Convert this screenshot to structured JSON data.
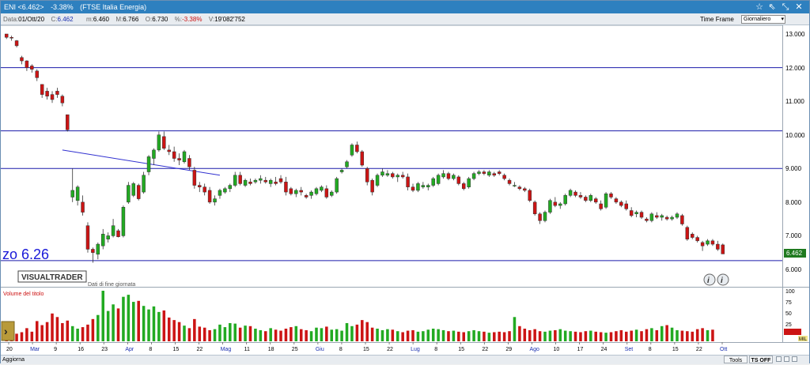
{
  "window": {
    "title_symbol": "ENI <6.462>",
    "title_change": "-3.38%",
    "title_index": "(FTSE Italia Energia)"
  },
  "info": {
    "date_label": "Data:",
    "date": "01/Ott/20",
    "close_label": "C:",
    "close": "6.462",
    "low_label": "m:",
    "low": "6.460",
    "high_label": "M:",
    "high": "6.766",
    "open_label": "O:",
    "open": "6.730",
    "pct_label": "%:",
    "pct": "-3.38%",
    "vol_label": "V:",
    "volume": "19'082'752"
  },
  "timeframe": {
    "label": "Time Frame",
    "selected": "Giornaliero"
  },
  "price_axis": {
    "ticks": [
      "13.000",
      "12.000",
      "11.000",
      "10.000",
      "9.000",
      "8.000",
      "7.000",
      "6.000"
    ],
    "last_price_badge": "6.462"
  },
  "volume_axis": {
    "ticks": [
      "100",
      "75",
      "50",
      "25"
    ],
    "unit": "MIL",
    "title": "Volume del titolo"
  },
  "overlay_text": "zo 6.26",
  "logo": {
    "text": "VISUALTRADER",
    "subtitle": "Dati di fine giornata"
  },
  "x_axis": {
    "labels": [
      "20",
      "Mar",
      "9",
      "16",
      "23",
      "Apr",
      "8",
      "15",
      "22",
      "Mag",
      "11",
      "18",
      "25",
      "Giu",
      "8",
      "15",
      "22",
      "Lug",
      "8",
      "15",
      "22",
      "29",
      "Ago",
      "10",
      "17",
      "24",
      "Set",
      "8",
      "15",
      "22",
      "Ott"
    ],
    "month_labels": [
      "Mar",
      "Apr",
      "Mag",
      "Giu",
      "Lug",
      "Ago",
      "Set",
      "Ott"
    ]
  },
  "bottom": {
    "refresh": "Aggiorna",
    "tools": "Tools",
    "ts_off": "TS OFF"
  },
  "colors": {
    "up": "#22aa22",
    "down": "#cc1414",
    "hline": "#1a1aaa",
    "trend": "#3030d0"
  },
  "chart_data": {
    "type": "candlestick",
    "title": "ENI <6.462> -3.38% (FTSE Italia Energia)",
    "ylim": [
      5.8,
      13.2
    ],
    "horizontal_levels": [
      12.0,
      10.12,
      9.0,
      6.26
    ],
    "trendline": [
      [
        11,
        9.55
      ],
      [
        42,
        8.8
      ]
    ],
    "candles": [
      [
        13.0,
        12.95,
        12.85,
        12.9
      ],
      [
        12.9,
        12.95,
        12.8,
        12.88
      ],
      [
        12.8,
        12.82,
        12.6,
        12.65
      ],
      [
        12.3,
        12.35,
        12.1,
        12.2
      ],
      [
        12.2,
        12.22,
        11.9,
        12.0
      ],
      [
        12.05,
        12.1,
        11.85,
        11.95
      ],
      [
        11.9,
        11.95,
        11.6,
        11.7
      ],
      [
        11.5,
        11.5,
        11.1,
        11.2
      ],
      [
        11.3,
        11.4,
        11.05,
        11.15
      ],
      [
        11.2,
        11.3,
        10.95,
        11.05
      ],
      [
        11.3,
        11.4,
        11.1,
        11.2
      ],
      [
        11.15,
        11.2,
        10.85,
        10.95
      ],
      [
        10.6,
        10.6,
        10.1,
        10.15
      ],
      [
        8.15,
        9.0,
        8.0,
        8.35
      ],
      [
        8.05,
        8.5,
        7.9,
        8.45
      ],
      [
        8.0,
        8.2,
        7.6,
        7.7
      ],
      [
        7.3,
        7.4,
        6.5,
        6.6
      ],
      [
        6.6,
        6.65,
        6.2,
        6.5
      ],
      [
        6.45,
        6.8,
        6.3,
        6.75
      ],
      [
        6.7,
        7.2,
        6.6,
        7.05
      ],
      [
        6.9,
        7.1,
        6.8,
        7.0
      ],
      [
        7.0,
        7.5,
        6.95,
        7.3
      ],
      [
        7.15,
        7.2,
        6.95,
        6.97
      ],
      [
        7.0,
        7.9,
        6.95,
        7.85
      ],
      [
        8.0,
        8.6,
        7.95,
        8.5
      ],
      [
        8.2,
        8.6,
        8.15,
        8.55
      ],
      [
        8.5,
        8.55,
        8.05,
        8.1
      ],
      [
        8.3,
        8.9,
        8.25,
        8.8
      ],
      [
        8.9,
        9.4,
        8.8,
        9.35
      ],
      [
        9.3,
        9.6,
        9.1,
        9.55
      ],
      [
        9.55,
        10.1,
        9.5,
        10.0
      ],
      [
        9.95,
        10.1,
        9.55,
        9.6
      ],
      [
        9.55,
        9.7,
        9.4,
        9.5
      ],
      [
        9.5,
        9.65,
        9.2,
        9.3
      ],
      [
        9.3,
        9.45,
        9.1,
        9.25
      ],
      [
        9.2,
        9.55,
        9.15,
        9.5
      ],
      [
        9.3,
        9.4,
        8.95,
        9.05
      ],
      [
        8.95,
        9.05,
        8.4,
        8.5
      ],
      [
        8.5,
        8.6,
        8.3,
        8.45
      ],
      [
        8.45,
        8.55,
        8.2,
        8.3
      ],
      [
        8.35,
        8.45,
        7.95,
        8.0
      ],
      [
        8.0,
        8.2,
        7.9,
        8.1
      ],
      [
        8.2,
        8.4,
        8.1,
        8.35
      ],
      [
        8.3,
        8.45,
        8.25,
        8.4
      ],
      [
        8.4,
        8.55,
        8.3,
        8.5
      ],
      [
        8.5,
        8.9,
        8.45,
        8.8
      ],
      [
        8.8,
        8.9,
        8.5,
        8.55
      ],
      [
        8.5,
        8.7,
        8.45,
        8.65
      ],
      [
        8.6,
        8.7,
        8.5,
        8.55
      ],
      [
        8.6,
        8.7,
        8.55,
        8.65
      ],
      [
        8.65,
        8.8,
        8.55,
        8.7
      ],
      [
        8.65,
        8.75,
        8.55,
        8.6
      ],
      [
        8.55,
        8.7,
        8.45,
        8.65
      ],
      [
        8.6,
        8.75,
        8.5,
        8.55
      ],
      [
        8.7,
        8.8,
        8.55,
        8.6
      ],
      [
        8.6,
        8.75,
        8.2,
        8.3
      ],
      [
        8.4,
        8.45,
        8.2,
        8.25
      ],
      [
        8.25,
        8.4,
        8.15,
        8.35
      ],
      [
        8.35,
        8.45,
        8.2,
        8.3
      ],
      [
        8.2,
        8.25,
        8.1,
        8.15
      ],
      [
        8.2,
        8.35,
        8.1,
        8.3
      ],
      [
        8.25,
        8.45,
        8.2,
        8.4
      ],
      [
        8.35,
        8.5,
        8.3,
        8.45
      ],
      [
        8.4,
        8.5,
        8.1,
        8.15
      ],
      [
        8.2,
        8.35,
        8.15,
        8.3
      ],
      [
        8.3,
        8.75,
        8.25,
        8.7
      ],
      [
        8.9,
        9.0,
        8.85,
        8.95
      ],
      [
        9.05,
        9.25,
        9.0,
        9.2
      ],
      [
        9.4,
        9.75,
        9.35,
        9.7
      ],
      [
        9.7,
        9.8,
        9.45,
        9.5
      ],
      [
        9.5,
        9.55,
        9.05,
        9.1
      ],
      [
        9.0,
        9.05,
        8.5,
        8.6
      ],
      [
        8.65,
        8.7,
        8.2,
        8.3
      ],
      [
        8.5,
        8.85,
        8.45,
        8.8
      ],
      [
        8.8,
        9.0,
        8.75,
        8.9
      ],
      [
        8.8,
        8.95,
        8.75,
        8.85
      ],
      [
        8.85,
        8.9,
        8.7,
        8.75
      ],
      [
        8.75,
        8.85,
        8.6,
        8.8
      ],
      [
        8.8,
        8.9,
        8.7,
        8.75
      ],
      [
        8.75,
        8.85,
        8.35,
        8.45
      ],
      [
        8.45,
        8.55,
        8.3,
        8.35
      ],
      [
        8.35,
        8.6,
        8.3,
        8.55
      ],
      [
        8.45,
        8.6,
        8.4,
        8.5
      ],
      [
        8.45,
        8.55,
        8.35,
        8.5
      ],
      [
        8.5,
        8.75,
        8.45,
        8.7
      ],
      [
        8.55,
        8.85,
        8.5,
        8.8
      ],
      [
        8.75,
        8.95,
        8.7,
        8.85
      ],
      [
        8.85,
        8.9,
        8.65,
        8.7
      ],
      [
        8.7,
        8.85,
        8.65,
        8.8
      ],
      [
        8.75,
        8.8,
        8.5,
        8.55
      ],
      [
        8.55,
        8.6,
        8.35,
        8.4
      ],
      [
        8.45,
        8.75,
        8.4,
        8.7
      ],
      [
        8.7,
        8.9,
        8.65,
        8.85
      ],
      [
        8.85,
        8.95,
        8.8,
        8.9
      ],
      [
        8.9,
        8.95,
        8.8,
        8.85
      ],
      [
        8.8,
        8.95,
        8.75,
        8.9
      ],
      [
        8.85,
        8.9,
        8.75,
        8.8
      ],
      [
        8.9,
        8.95,
        8.8,
        8.85
      ],
      [
        8.8,
        8.85,
        8.65,
        8.7
      ],
      [
        8.65,
        8.7,
        8.5,
        8.55
      ],
      [
        8.5,
        8.6,
        8.45,
        8.5
      ],
      [
        8.45,
        8.5,
        8.35,
        8.4
      ],
      [
        8.4,
        8.45,
        8.3,
        8.35
      ],
      [
        8.35,
        8.4,
        8.0,
        8.05
      ],
      [
        8.0,
        8.05,
        7.6,
        7.65
      ],
      [
        7.65,
        7.7,
        7.35,
        7.45
      ],
      [
        7.45,
        7.75,
        7.4,
        7.7
      ],
      [
        7.7,
        8.1,
        7.65,
        8.05
      ],
      [
        8.0,
        8.15,
        7.85,
        7.9
      ],
      [
        7.9,
        8.0,
        7.8,
        7.95
      ],
      [
        7.95,
        8.25,
        7.9,
        8.2
      ],
      [
        8.2,
        8.4,
        8.15,
        8.35
      ],
      [
        8.3,
        8.35,
        8.15,
        8.2
      ],
      [
        8.2,
        8.3,
        8.1,
        8.15
      ],
      [
        8.15,
        8.2,
        8.0,
        8.05
      ],
      [
        8.05,
        8.25,
        8.0,
        8.2
      ],
      [
        8.1,
        8.15,
        7.95,
        8.0
      ],
      [
        7.95,
        8.05,
        7.75,
        7.8
      ],
      [
        7.85,
        8.3,
        7.8,
        8.25
      ],
      [
        8.25,
        8.3,
        8.1,
        8.15
      ],
      [
        8.1,
        8.15,
        7.95,
        8.0
      ],
      [
        8.0,
        8.05,
        7.85,
        7.9
      ],
      [
        7.95,
        8.05,
        7.75,
        7.8
      ],
      [
        7.75,
        7.85,
        7.55,
        7.6
      ],
      [
        7.65,
        7.75,
        7.55,
        7.7
      ],
      [
        7.7,
        7.75,
        7.5,
        7.55
      ],
      [
        7.5,
        7.55,
        7.4,
        7.45
      ],
      [
        7.45,
        7.7,
        7.4,
        7.65
      ],
      [
        7.6,
        7.7,
        7.5,
        7.55
      ],
      [
        7.55,
        7.65,
        7.45,
        7.6
      ],
      [
        7.55,
        7.6,
        7.45,
        7.5
      ],
      [
        7.5,
        7.6,
        7.45,
        7.55
      ],
      [
        7.55,
        7.7,
        7.5,
        7.65
      ],
      [
        7.6,
        7.65,
        7.3,
        7.35
      ],
      [
        7.25,
        7.3,
        6.85,
        6.9
      ],
      [
        7.05,
        7.1,
        6.9,
        6.95
      ],
      [
        6.95,
        7.0,
        6.8,
        6.85
      ],
      [
        6.8,
        6.85,
        6.55,
        6.7
      ],
      [
        6.75,
        6.9,
        6.7,
        6.85
      ],
      [
        6.85,
        6.9,
        6.7,
        6.75
      ],
      [
        6.75,
        6.85,
        6.55,
        6.6
      ],
      [
        6.73,
        6.77,
        6.46,
        6.46
      ]
    ],
    "volumes": [
      22,
      34,
      15,
      18,
      26,
      19,
      40,
      32,
      38,
      55,
      48,
      36,
      41,
      30,
      25,
      28,
      33,
      44,
      52,
      100,
      60,
      73,
      65,
      88,
      92,
      78,
      80,
      70,
      63,
      69,
      58,
      61,
      47,
      42,
      38,
      31,
      26,
      44,
      29,
      27,
      22,
      24,
      33,
      28,
      36,
      35,
      27,
      31,
      30,
      25,
      22,
      20,
      26,
      23,
      21,
      25,
      28,
      30,
      24,
      22,
      20,
      27,
      26,
      29,
      23,
      24,
      21,
      36,
      30,
      33,
      42,
      38,
      27,
      25,
      22,
      24,
      23,
      20,
      18,
      21,
      22,
      19,
      20,
      23,
      25,
      24,
      22,
      20,
      21,
      19,
      18,
      20,
      22,
      20,
      19,
      17,
      18,
      19,
      18,
      20,
      48,
      30,
      25,
      22,
      24,
      20,
      19,
      21,
      22,
      24,
      21,
      20,
      19,
      18,
      20,
      21,
      19,
      18,
      17,
      18,
      20,
      22,
      19,
      21,
      23,
      20,
      24,
      26,
      22,
      30,
      32,
      27,
      22,
      21,
      20,
      19,
      24,
      26,
      22,
      23
    ]
  }
}
